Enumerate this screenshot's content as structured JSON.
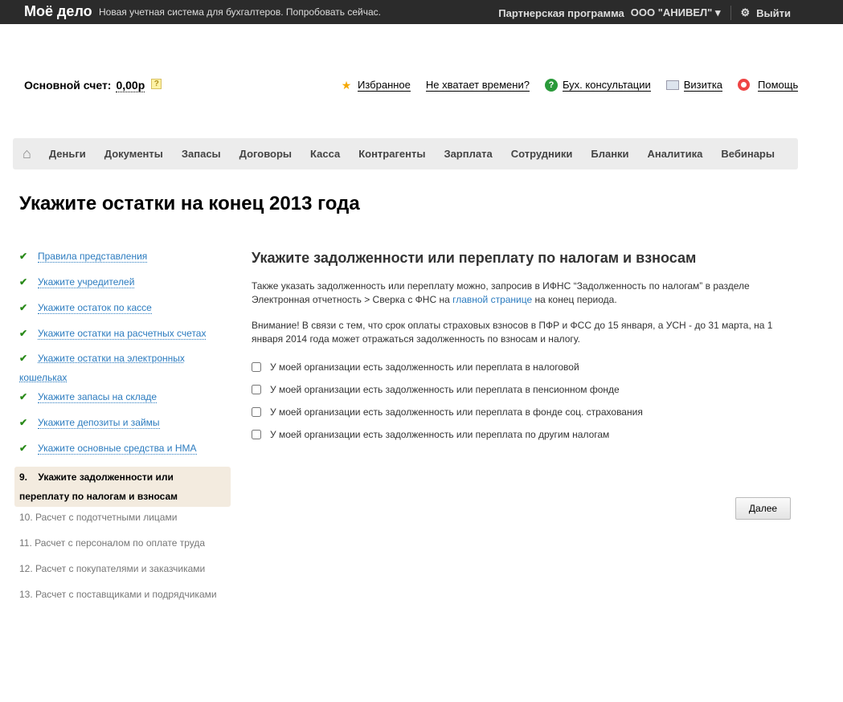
{
  "topbar": {
    "logo": "Моё дело",
    "promo": "Новая учетная система для бухгалтеров. Попробовать сейчас.",
    "partner": "Партнерская программа",
    "org": "ООО \"АНИВЕЛ\"",
    "logout": "Выйти"
  },
  "account": {
    "label": "Основной счет:",
    "value": "0,00р",
    "help": "?"
  },
  "links": [
    "Избранное",
    "Не хватает времени?",
    "Бух. консультации",
    "Визитка",
    "Помощь"
  ],
  "nav": [
    "Деньги",
    "Документы",
    "Запасы",
    "Договоры",
    "Касса",
    "Контрагенты",
    "Зарплата",
    "Сотрудники",
    "Бланки",
    "Аналитика",
    "Вебинары"
  ],
  "title": "Укажите остатки на конец 2013 года",
  "steps_done": [
    "Правила представления",
    "Укажите учредителей",
    "Укажите остаток по кассе",
    "Укажите остатки на расчетных счетах",
    "Укажите остатки на электронных кошельках",
    "Укажите запасы на складе",
    "Укажите депозиты и займы",
    "Укажите основные средства и НМА"
  ],
  "step_active": {
    "num": "9.",
    "label": "Укажите задолженности или переплату по налогам и взносам"
  },
  "steps_pending": [
    "10.  Расчет с подотчетными лицами",
    "11.  Расчет с персоналом по оплате труда",
    "12.  Расчет с покупателями и заказчиками",
    "13.  Расчет с поставщиками и подрядчиками"
  ],
  "main": {
    "heading": "Укажите задолженности или переплату по налогам и взносам",
    "p1a": "Также указать задолженность или переплату можно, запросив в ИФНС “Задолженность по налогам” в разделе Электронная отчетность > Сверка с ФНС на ",
    "p1link": "главной странице",
    "p1b": " на конец периода.",
    "p2": "Внимание! В связи с тем, что срок оплаты страховых взносов в ПФР и ФСС до 15 января, а УСН - до 31 марта, на 1 января 2014 года может отражаться задолженность по взносам и налогу.",
    "checkboxes": [
      "У моей организации есть задолженность или переплата в налоговой",
      "У моей организации есть задолженность или переплата в пенсионном фонде",
      "У моей организации есть задолженность или переплата в фонде соц. страхования",
      "У моей организации есть задолженность или переплата по другим налогам"
    ],
    "next": "Далее"
  }
}
